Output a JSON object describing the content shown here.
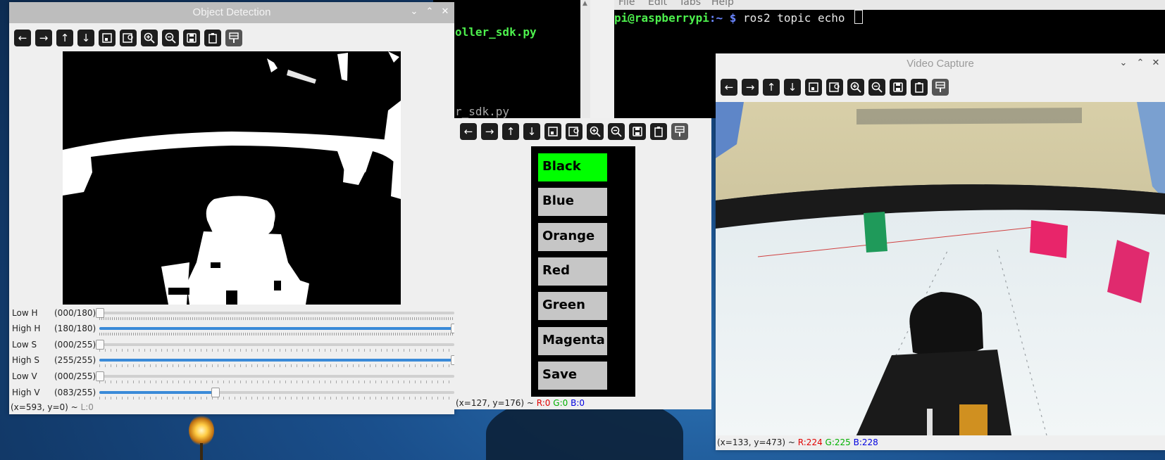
{
  "desktop": {
    "wallpaper": "blue-night"
  },
  "terminal_left": {
    "lines": [
      "oller_sdk.py",
      "r_sdk.py"
    ]
  },
  "terminal_right": {
    "menu": [
      "File",
      "Edit",
      "Tabs",
      "Help"
    ],
    "prompt_user": "pi@raspberrypi",
    "prompt_path": ":~ ",
    "prompt_symbol": "$",
    "command": " ros2 topic echo "
  },
  "object_detection": {
    "title": "Object Detection",
    "toolbar": [
      "arrow-left",
      "arrow-right",
      "arrow-up",
      "arrow-down",
      "zoom-fit",
      "zoom-rect",
      "zoom-in",
      "zoom-out",
      "save",
      "copy",
      "properties"
    ],
    "sliders": [
      {
        "label": "Low H",
        "value_text": "(000/180)",
        "value": 0,
        "max": 180
      },
      {
        "label": "High H",
        "value_text": "(180/180)",
        "value": 180,
        "max": 180
      },
      {
        "label": "Low S",
        "value_text": "(000/255)",
        "value": 0,
        "max": 255
      },
      {
        "label": "High S",
        "value_text": "(255/255)",
        "value": 255,
        "max": 255
      },
      {
        "label": "Low V",
        "value_text": "(000/255)",
        "value": 0,
        "max": 255
      },
      {
        "label": "High V",
        "value_text": "(083/255)",
        "value": 83,
        "max": 255
      }
    ],
    "status": {
      "coords": "(x=593, y=0) ~ ",
      "l": "L:0"
    }
  },
  "color_selector": {
    "buttons": [
      "Black",
      "Blue",
      "Orange",
      "Red",
      "Green",
      "Magenta",
      "Save"
    ],
    "active": "Black",
    "active_color": "#00ff00",
    "status": {
      "coords": "(x=127, y=176) ~ ",
      "r": "R:0",
      "g": "G:0",
      "b": "B:0"
    }
  },
  "video_capture": {
    "title": "Video Capture",
    "status": {
      "coords": "(x=133, y=473) ~ ",
      "r": "R:224",
      "g": "G:225",
      "b": "B:228"
    }
  }
}
